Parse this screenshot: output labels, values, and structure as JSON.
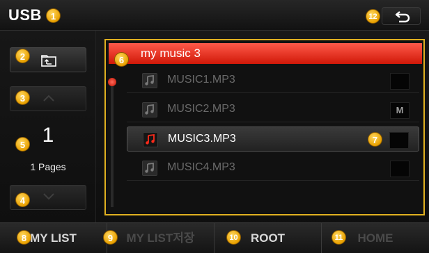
{
  "title": "USB",
  "callouts": [
    "1",
    "2",
    "3",
    "4",
    "5",
    "6",
    "7",
    "8",
    "9",
    "10",
    "11",
    "12"
  ],
  "left_panel": {
    "page_number": "1",
    "pages_label": "1 Pages"
  },
  "folder": {
    "name": "my music 3"
  },
  "files": [
    {
      "name": "MUSIC1.MP3",
      "badge": "",
      "selected": false
    },
    {
      "name": "MUSIC2.MP3",
      "badge": "M",
      "selected": false
    },
    {
      "name": "MUSIC3.MP3",
      "badge": "",
      "selected": true
    },
    {
      "name": "MUSIC4.MP3",
      "badge": "",
      "selected": false
    }
  ],
  "bottom_bar": {
    "my_list": "MY LIST",
    "my_list_save": "MY LIST저장",
    "root": "ROOT",
    "home": "HOME"
  },
  "colors": {
    "accent_red": "#e0281a",
    "frame_yellow": "#e0b020",
    "callout_orange": "#f0b010"
  },
  "icons": [
    "back-arrow-icon",
    "folder-up-icon",
    "chevron-up-icon",
    "chevron-down-icon",
    "music-note-icon"
  ]
}
